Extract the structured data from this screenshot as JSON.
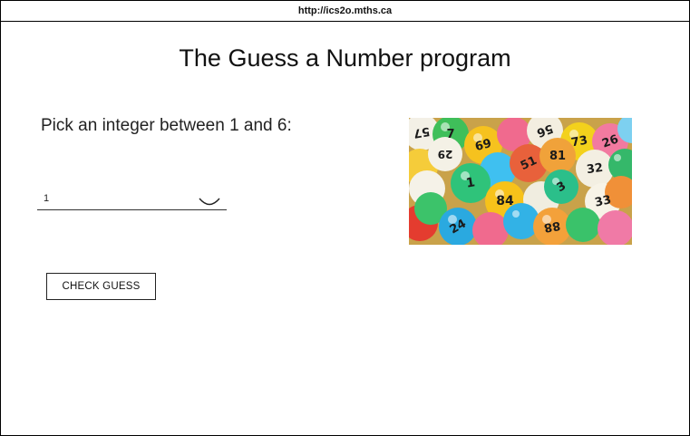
{
  "browser": {
    "url": "http://ics2o.mths.ca"
  },
  "page": {
    "title": "The Guess a Number program",
    "prompt": "Pick an integer between 1 and 6:",
    "select": {
      "value": "1"
    },
    "check_button_label": "CHECK GUESS"
  },
  "image": {
    "subject": "lottery-balls",
    "ball_numbers": [
      "57",
      "7",
      "69",
      "56",
      "73",
      "26",
      "29",
      "51",
      "81",
      "32",
      "1",
      "3",
      "84",
      "33",
      "88",
      "24"
    ]
  }
}
